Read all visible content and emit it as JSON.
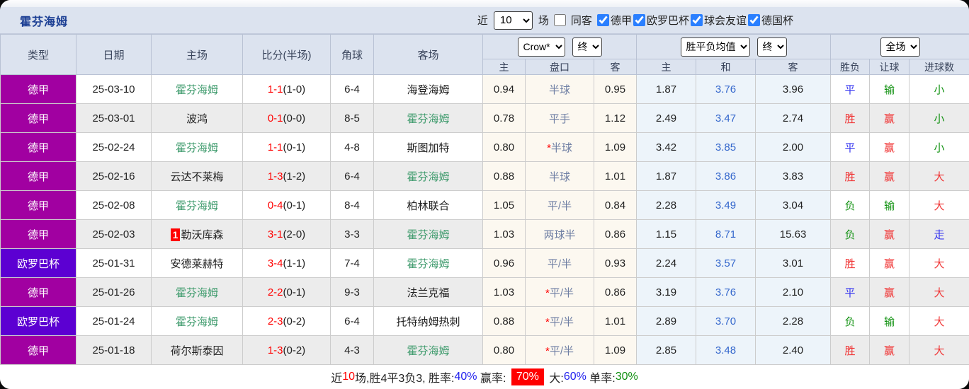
{
  "title": "霍芬海姆",
  "toolbar": {
    "near_label": "近",
    "matches_count": "10",
    "matches_label": "场",
    "same_opponent": {
      "label": "同客",
      "checked": false
    },
    "leagues": [
      {
        "label": "德甲",
        "checked": true
      },
      {
        "label": "欧罗巴杯",
        "checked": true
      },
      {
        "label": "球会友谊",
        "checked": true
      },
      {
        "label": "德国杯",
        "checked": true
      }
    ]
  },
  "table": {
    "main_headers": [
      "类型",
      "日期",
      "主场",
      "比分(半场)",
      "角球",
      "客场"
    ],
    "group_controls": {
      "odds_company": "Crow*",
      "odds_final": "终",
      "europe_avg": "胜平负均值",
      "europe_final": "终",
      "scope": "全场"
    },
    "sub_headers": {
      "odds": [
        "主",
        "盘口",
        "客"
      ],
      "europe": [
        "主",
        "和",
        "客"
      ],
      "result": [
        "胜负",
        "让球",
        "进球数"
      ]
    },
    "rows": [
      {
        "league": "德甲",
        "date": "25-03-10",
        "home": "霍芬海姆",
        "home_rank": "",
        "score": "1-1",
        "half": "(1-0)",
        "corners": "6-4",
        "away": "海登海姆",
        "asia_home": "0.94",
        "handicap": "半球",
        "asia_away": "0.95",
        "ep_home": "1.87",
        "ep_draw": "3.76",
        "ep_away": "3.96",
        "result": "平",
        "handicap_result": "输",
        "goals": "小"
      },
      {
        "league": "德甲",
        "date": "25-03-01",
        "home": "波鸿",
        "home_rank": "",
        "score": "0-1",
        "half": "(0-0)",
        "corners": "8-5",
        "away": "霍芬海姆",
        "asia_home": "0.78",
        "handicap": "平手",
        "asia_away": "1.12",
        "ep_home": "2.49",
        "ep_draw": "3.47",
        "ep_away": "2.74",
        "result": "胜",
        "handicap_result": "赢",
        "goals": "小"
      },
      {
        "league": "德甲",
        "date": "25-02-24",
        "home": "霍芬海姆",
        "home_rank": "",
        "score": "1-1",
        "half": "(0-1)",
        "corners": "4-8",
        "away": "斯图加特",
        "asia_home": "0.80",
        "handicap": "*半球",
        "asia_away": "1.09",
        "ep_home": "3.42",
        "ep_draw": "3.85",
        "ep_away": "2.00",
        "result": "平",
        "handicap_result": "赢",
        "goals": "小"
      },
      {
        "league": "德甲",
        "date": "25-02-16",
        "home": "云达不莱梅",
        "home_rank": "",
        "score": "1-3",
        "half": "(1-2)",
        "corners": "6-4",
        "away": "霍芬海姆",
        "asia_home": "0.88",
        "handicap": "半球",
        "asia_away": "1.01",
        "ep_home": "1.87",
        "ep_draw": "3.86",
        "ep_away": "3.83",
        "result": "胜",
        "handicap_result": "赢",
        "goals": "大"
      },
      {
        "league": "德甲",
        "date": "25-02-08",
        "home": "霍芬海姆",
        "home_rank": "",
        "score": "0-4",
        "half": "(0-1)",
        "corners": "8-4",
        "away": "柏林联合",
        "asia_home": "1.05",
        "handicap": "平/半",
        "asia_away": "0.84",
        "ep_home": "2.28",
        "ep_draw": "3.49",
        "ep_away": "3.04",
        "result": "负",
        "handicap_result": "输",
        "goals": "大"
      },
      {
        "league": "德甲",
        "date": "25-02-03",
        "home": "勒沃库森",
        "home_rank": "1",
        "score": "3-1",
        "half": "(2-0)",
        "corners": "3-3",
        "away": "霍芬海姆",
        "asia_home": "1.03",
        "handicap": "两球半",
        "asia_away": "0.86",
        "ep_home": "1.15",
        "ep_draw": "8.71",
        "ep_away": "15.63",
        "result": "负",
        "handicap_result": "赢",
        "goals": "走"
      },
      {
        "league": "欧罗巴杯",
        "date": "25-01-31",
        "home": "安德莱赫特",
        "home_rank": "",
        "score": "3-4",
        "half": "(1-1)",
        "corners": "7-4",
        "away": "霍芬海姆",
        "asia_home": "0.96",
        "handicap": "平/半",
        "asia_away": "0.93",
        "ep_home": "2.24",
        "ep_draw": "3.57",
        "ep_away": "3.01",
        "result": "胜",
        "handicap_result": "赢",
        "goals": "大"
      },
      {
        "league": "德甲",
        "date": "25-01-26",
        "home": "霍芬海姆",
        "home_rank": "",
        "score": "2-2",
        "half": "(0-1)",
        "corners": "9-3",
        "away": "法兰克福",
        "asia_home": "1.03",
        "handicap": "*平/半",
        "asia_away": "0.86",
        "ep_home": "3.19",
        "ep_draw": "3.76",
        "ep_away": "2.10",
        "result": "平",
        "handicap_result": "赢",
        "goals": "大"
      },
      {
        "league": "欧罗巴杯",
        "date": "25-01-24",
        "home": "霍芬海姆",
        "home_rank": "",
        "score": "2-3",
        "half": "(0-2)",
        "corners": "6-4",
        "away": "托特纳姆热刺",
        "asia_home": "0.88",
        "handicap": "*平/半",
        "asia_away": "1.01",
        "ep_home": "2.89",
        "ep_draw": "3.70",
        "ep_away": "2.28",
        "result": "负",
        "handicap_result": "输",
        "goals": "大"
      },
      {
        "league": "德甲",
        "date": "25-01-18",
        "home": "荷尔斯泰因",
        "home_rank": "",
        "score": "1-3",
        "half": "(0-2)",
        "corners": "4-3",
        "away": "霍芬海姆",
        "asia_home": "0.80",
        "handicap": "*平/半",
        "asia_away": "1.09",
        "ep_home": "2.85",
        "ep_draw": "3.48",
        "ep_away": "2.40",
        "result": "胜",
        "handicap_result": "赢",
        "goals": "大"
      }
    ]
  },
  "subject_team": "霍芬海姆",
  "summary": {
    "segments": [
      {
        "text": "近",
        "style": "plain"
      },
      {
        "text": "10",
        "style": "red"
      },
      {
        "text": "场,胜4平3负3, 胜率:",
        "style": "plain"
      },
      {
        "text": "40%",
        "style": "blue"
      },
      {
        "text": " 赢率: ",
        "style": "plain"
      },
      {
        "text": "70%",
        "style": "badge"
      },
      {
        "text": " 大:",
        "style": "plain"
      },
      {
        "text": "60%",
        "style": "blue"
      },
      {
        "text": " 单率:",
        "style": "plain"
      },
      {
        "text": "30%",
        "style": "green"
      }
    ]
  },
  "colors": {
    "league_colors": {
      "德甲": "#a100a1",
      "欧罗巴杯": "#5c00d2"
    },
    "outcome_red": "#f03434",
    "outcome_blue": "#3434f0",
    "outcome_green": "#149314",
    "team_highlight": "#3f9b6d",
    "score_red": "#ff0000",
    "draw_odds_blue": "#3366cc",
    "title_blue": "#1c3f94",
    "summary_badge_bg": "#ff0000"
  }
}
